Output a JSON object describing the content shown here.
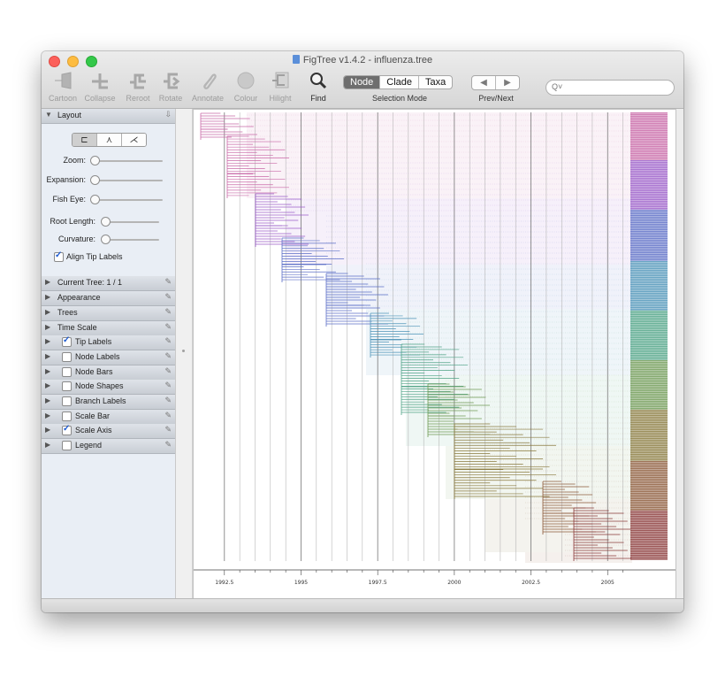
{
  "window": {
    "title": "FigTree v1.4.2 - influenza.tree"
  },
  "toolbar": {
    "cartoon": "Cartoon",
    "collapse": "Collapse",
    "reroot": "Reroot",
    "rotate": "Rotate",
    "annotate": "Annotate",
    "colour": "Colour",
    "hilight": "Hilight",
    "find": "Find",
    "selection_mode": {
      "options": [
        "Node",
        "Clade",
        "Taxa"
      ],
      "selected": "Node",
      "caption": "Selection Mode"
    },
    "prev_next": "Prev/Next",
    "search_placeholder": ""
  },
  "sidebar": {
    "layout": {
      "title": "Layout",
      "zoom": "Zoom:",
      "expansion": "Expansion:",
      "fish_eye": "Fish Eye:",
      "root_length": "Root Length:",
      "curvature": "Curvature:",
      "align_tip_labels": "Align Tip Labels",
      "align_tip_labels_checked": true
    },
    "panels": [
      {
        "label": "Current Tree: 1 / 1",
        "checkbox": false
      },
      {
        "label": "Appearance",
        "checkbox": false
      },
      {
        "label": "Trees",
        "checkbox": false
      },
      {
        "label": "Time Scale",
        "checkbox": false
      },
      {
        "label": "Tip Labels",
        "checkbox": true,
        "checked": true
      },
      {
        "label": "Node Labels",
        "checkbox": true,
        "checked": false
      },
      {
        "label": "Node Bars",
        "checkbox": true,
        "checked": false
      },
      {
        "label": "Node Shapes",
        "checkbox": true,
        "checked": false
      },
      {
        "label": "Branch Labels",
        "checkbox": true,
        "checked": false
      },
      {
        "label": "Scale Bar",
        "checkbox": true,
        "checked": false
      },
      {
        "label": "Scale Axis",
        "checkbox": true,
        "checked": true
      },
      {
        "label": "Legend",
        "checkbox": true,
        "checked": false
      }
    ]
  },
  "tree_view": {
    "scale_axis": {
      "min": 1991.9,
      "max": 2005.8,
      "ticks": [
        1992.5,
        1995,
        1997.5,
        2000,
        2002.5,
        2005
      ],
      "tick_labels": [
        "1992.5",
        "1995",
        "1997.5",
        "2000",
        "2002.5",
        "2005"
      ]
    },
    "clade_colors": [
      "#c96aa8",
      "#9b5ec9",
      "#5d6fc7",
      "#4e94b8",
      "#4fa386",
      "#6f9a55",
      "#8a7a3e",
      "#8c5a3a",
      "#8b3a3a"
    ]
  }
}
